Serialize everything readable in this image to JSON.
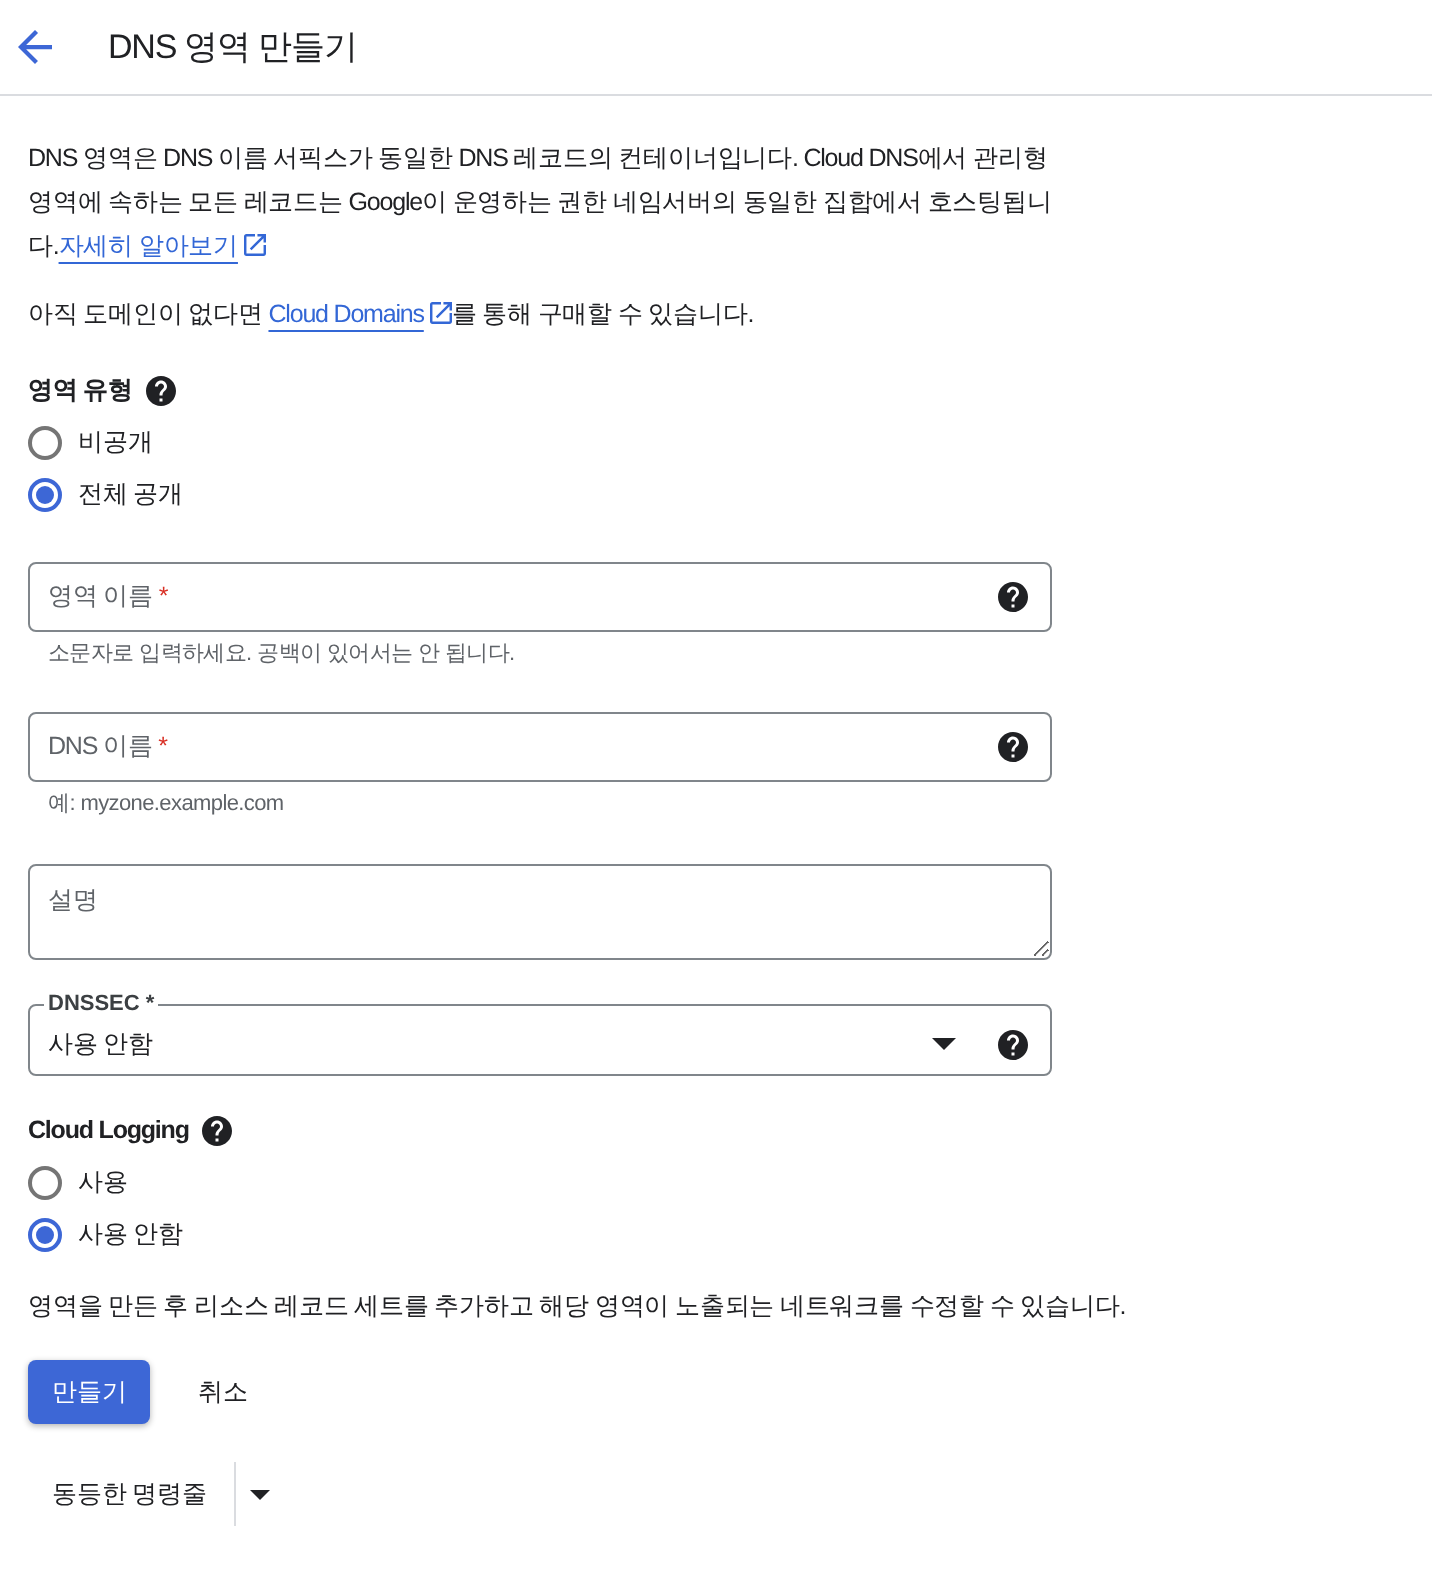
{
  "header": {
    "title": "DNS 영역 만들기"
  },
  "intro": {
    "text": "DNS 영역은 DNS 이름 서픽스가 동일한 DNS 레코드의 컨테이너입니다. Cloud DNS에서 관리형 영역에 속하는 모든 레코드는 Google이 운영하는 권한 네임서버의 동일한 집합에서 호스팅됩니다.",
    "link": "자세히 알아보기"
  },
  "purchase_note": {
    "before": "아직 도메인이 없다면 ",
    "link": "Cloud Domains",
    "after": "를 통해 구매할 수 있습니다."
  },
  "zone_type": {
    "label": "영역 유형",
    "help": true,
    "options": [
      {
        "label": "비공개",
        "selected": false
      },
      {
        "label": "전체 공개",
        "selected": true
      }
    ]
  },
  "fields": [
    {
      "kind": "input",
      "label": "영역 이름",
      "required_mark": "*",
      "help": true,
      "hint": "소문자로 입력하세요. 공백이 있어서는 안 됩니다."
    },
    {
      "kind": "input",
      "label": "DNS 이름",
      "required_mark": "*",
      "help": true,
      "hint": "예: myzone.example.com"
    },
    {
      "kind": "textarea",
      "placeholder": "설명"
    },
    {
      "kind": "select",
      "label": "DNSSEC",
      "required_mark": "*",
      "value": "사용 안함",
      "help": true
    }
  ],
  "cloud_logging": {
    "label": "Cloud Logging",
    "help": true,
    "options": [
      {
        "label": "사용",
        "selected": false
      },
      {
        "label": "사용 안함",
        "selected": true
      }
    ]
  },
  "footer_note": "영역을 만든 후 리소스 레코드 세트를 추가하고 해당 영역이 노출되는 네트워크를 수정할 수 있습니다.",
  "actions": [
    {
      "kind": "primary",
      "label": "만들기"
    },
    {
      "kind": "text",
      "label": "취소"
    }
  ],
  "command_line": {
    "label": "동등한 명령줄"
  }
}
